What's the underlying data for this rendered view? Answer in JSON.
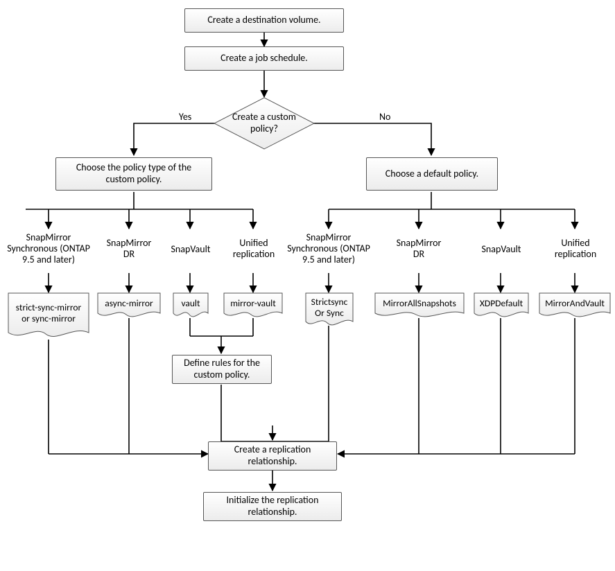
{
  "steps": {
    "create_dest_volume": "Create a destination volume.",
    "create_job_schedule": "Create a job schedule.",
    "create_custom_policy_q": "Create a custom policy?",
    "choose_custom_type": "Choose the policy type of the custom policy.",
    "choose_default": "Choose a default policy.",
    "define_rules": "Define rules for the custom policy.",
    "create_rel": "Create a replication relationship.",
    "init_rel": "Initialize the replication relationship."
  },
  "edges": {
    "yes": "Yes",
    "no": "No"
  },
  "custom_types": {
    "sm_sync": "SnapMirror Synchronous (ONTAP 9.5 and later)",
    "sm_dr": "SnapMirror DR",
    "snapvault": "SnapVault",
    "unified": "Unified replication"
  },
  "custom_values": {
    "sm_sync": "strict-sync-mirror or sync-mirror",
    "sm_dr": "async-mirror",
    "snapvault": "vault",
    "unified": "mirror-vault"
  },
  "default_types": {
    "sm_sync": "SnapMirror Synchronous (ONTAP 9.5 and later)",
    "sm_dr": "SnapMirror DR",
    "snapvault": "SnapVault",
    "unified": "Unified replication"
  },
  "default_values": {
    "sm_sync": "Strictsync Or Sync",
    "sm_dr": "MirrorAllSnapshots",
    "snapvault": "XDPDefault",
    "unified": "MirrorAndVault"
  }
}
